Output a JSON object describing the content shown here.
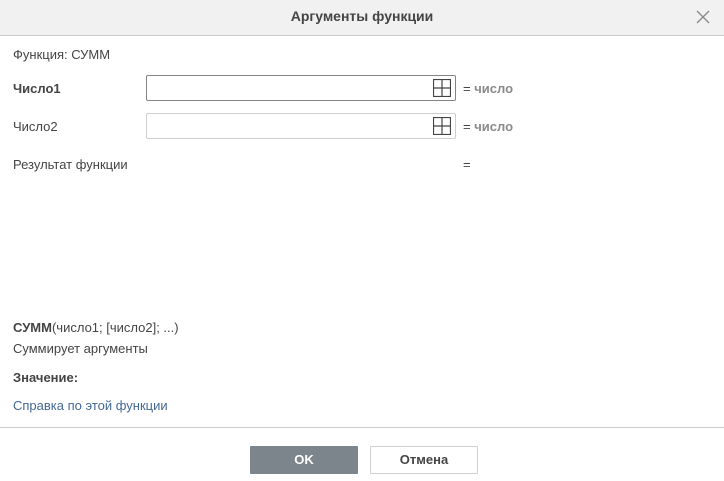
{
  "dialog": {
    "title": "Аргументы функции",
    "close_icon": "close-icon"
  },
  "function": {
    "label": "Функция: СУММ"
  },
  "arguments": [
    {
      "label": "Число1",
      "value": "",
      "type_prefix": "= ",
      "type_word": "число",
      "active": true
    },
    {
      "label": "Число2",
      "value": "",
      "type_prefix": "= ",
      "type_word": "число",
      "active": false
    }
  ],
  "result": {
    "label": "Результат функции",
    "value": "="
  },
  "syntax": {
    "name": "СУММ",
    "args": "(число1; [число2]; ...)",
    "description": "Суммирует аргументы"
  },
  "value_label": "Значение:",
  "help_link": "Справка по этой функции",
  "buttons": {
    "ok": "OK",
    "cancel": "Отмена"
  },
  "colors": {
    "link": "#446995",
    "ok_button": "#7d858c",
    "header_bg": "#f1f1f1"
  }
}
